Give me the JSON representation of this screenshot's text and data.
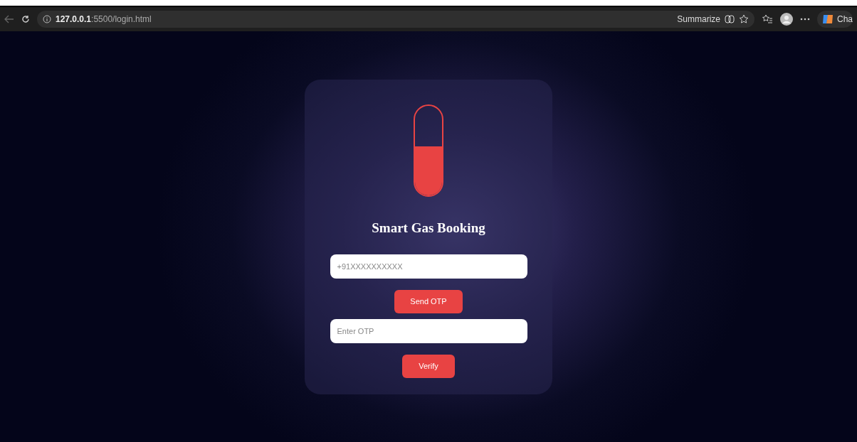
{
  "browser": {
    "url": "**127.0.0.1**:5500/login.html",
    "summarize": "Summarize",
    "copilot": "Cha"
  },
  "card": {
    "gauge": {
      "level": 0.55
    },
    "title": "Smart Gas Booking",
    "phone": {
      "placeholder": "+91XXXXXXXXXX"
    },
    "send_button": "Send OTP",
    "otp": {
      "placeholder": "Enter OTP"
    },
    "verify_button": "Verify"
  }
}
